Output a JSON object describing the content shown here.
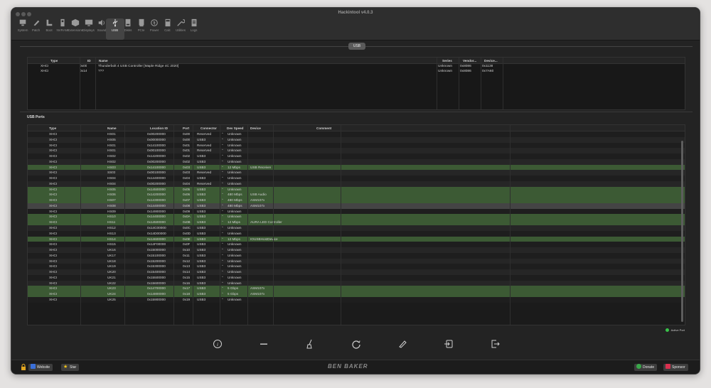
{
  "window": {
    "title": "Hackintool v4.0.3"
  },
  "toolbar": [
    {
      "label": "System",
      "icon": "monitor-icon"
    },
    {
      "label": "Patch",
      "icon": "pencil-icon"
    },
    {
      "label": "Boot",
      "icon": "boot-icon"
    },
    {
      "label": "NVRAM",
      "icon": "chip-icon"
    },
    {
      "label": "Extensions",
      "icon": "cube-icon"
    },
    {
      "label": "Displays",
      "icon": "display-icon"
    },
    {
      "label": "Sound",
      "icon": "speaker-icon"
    },
    {
      "label": "USB",
      "icon": "usb-icon",
      "active": true
    },
    {
      "label": "Disks",
      "icon": "disk-icon"
    },
    {
      "label": "PCIe",
      "icon": "card-icon"
    },
    {
      "label": "Power",
      "icon": "power-icon"
    },
    {
      "label": "Calc",
      "icon": "calculator-icon"
    },
    {
      "label": "Utilities",
      "icon": "wrench-icon"
    },
    {
      "label": "Logs",
      "icon": "log-icon"
    }
  ],
  "section_tab": "USB",
  "controllers": {
    "headers": {
      "type": "Type",
      "id": "ID",
      "name": "Name",
      "series": "Series",
      "vendor": "Vendor...",
      "device": "Device..."
    },
    "rows": [
      {
        "type": "XHCI",
        "id": "0x00",
        "name": "Thunderbolt 4 USB Controller [Maple Ridge 4C 2020]",
        "series": "Unknown",
        "vendor": "0x8086",
        "device": "0x1138"
      },
      {
        "type": "XHCI",
        "id": "0x14",
        "name": "???",
        "series": "Unknown",
        "vendor": "0x8086",
        "device": "0x7A60"
      }
    ]
  },
  "ports": {
    "label": "USB Ports",
    "headers": {
      "type": "Type",
      "name": "Name",
      "location": "Location ID",
      "port": "Port",
      "connector": "Connector",
      "speed": "Dev Speed",
      "device": "Device",
      "comment": "Comment"
    },
    "rows": [
      {
        "type": "XHCI",
        "name": "HS01",
        "location": "0x00200000",
        "port": "0x00",
        "connector": "Reserved",
        "speed": "Unknown",
        "device": "",
        "hl": ""
      },
      {
        "type": "XHCI",
        "name": "HS05",
        "location": "0x00000000",
        "port": "0x00",
        "connector": "USB3",
        "speed": "Unknown",
        "device": "",
        "hl": ""
      },
      {
        "type": "XHCI",
        "name": "HS01",
        "location": "0x14100000",
        "port": "0x01",
        "connector": "Reserved",
        "speed": "Unknown",
        "device": "",
        "hl": ""
      },
      {
        "type": "XHCI",
        "name": "HS01",
        "location": "0x00100000",
        "port": "0x01",
        "connector": "Reserved",
        "speed": "Unknown",
        "device": "",
        "hl": ""
      },
      {
        "type": "XHCI",
        "name": "HS02",
        "location": "0x14200000",
        "port": "0x02",
        "connector": "USB3",
        "speed": "Unknown",
        "device": "",
        "hl": ""
      },
      {
        "type": "XHCI",
        "name": "HS02",
        "location": "0x00200000",
        "port": "0x02",
        "connector": "USB3",
        "speed": "Unknown",
        "device": "",
        "hl": ""
      },
      {
        "type": "XHCI",
        "name": "HS03",
        "location": "0x14100000",
        "port": "0x03",
        "connector": "USB3",
        "speed": "12 Mbps",
        "device": "USB Receiver",
        "hl": "green"
      },
      {
        "type": "XHCI",
        "name": "SS03",
        "location": "0x00100000",
        "port": "0x03",
        "connector": "Reserved",
        "speed": "Unknown",
        "device": "",
        "hl": ""
      },
      {
        "type": "XHCI",
        "name": "HS04",
        "location": "0x14400000",
        "port": "0x04",
        "connector": "USB3",
        "speed": "Unknown",
        "device": "",
        "hl": ""
      },
      {
        "type": "XHCI",
        "name": "HS04",
        "location": "0x00200000",
        "port": "0x04",
        "connector": "Reserved",
        "speed": "Unknown",
        "device": "",
        "hl": ""
      },
      {
        "type": "XHCI",
        "name": "HS05",
        "location": "0x14500000",
        "port": "0x05",
        "connector": "USB3",
        "speed": "Unknown",
        "device": "",
        "hl": "green"
      },
      {
        "type": "XHCI",
        "name": "HS06",
        "location": "0x14200000",
        "port": "0x06",
        "connector": "USB3",
        "speed": "480 Mbps",
        "device": "USB Audio",
        "hl": "green"
      },
      {
        "type": "XHCI",
        "name": "HS07",
        "location": "0x14300000",
        "port": "0x07",
        "connector": "USB3",
        "speed": "480 Mbps",
        "device": "ASM107x",
        "hl": "green"
      },
      {
        "type": "XHCI",
        "name": "HS08",
        "location": "0x14400000",
        "port": "0x08",
        "connector": "USB3",
        "speed": "480 Mbps",
        "device": "ASM107x",
        "hl": "sel"
      },
      {
        "type": "XHCI",
        "name": "HS09",
        "location": "0x14900000",
        "port": "0x09",
        "connector": "USB3",
        "speed": "Unknown",
        "device": "",
        "hl": ""
      },
      {
        "type": "XHCI",
        "name": "HS10",
        "location": "0x14400000",
        "port": "0x0A",
        "connector": "USB3",
        "speed": "Unknown",
        "device": "",
        "hl": "green"
      },
      {
        "type": "XHCI",
        "name": "HS11",
        "location": "0x14500000",
        "port": "0x0B",
        "connector": "USB3",
        "speed": "12 Mbps",
        "device": "AURA LED Controller",
        "hl": "green"
      },
      {
        "type": "XHCI",
        "name": "HS12",
        "location": "0x14C00000",
        "port": "0x0C",
        "connector": "USB3",
        "speed": "Unknown",
        "device": "",
        "hl": ""
      },
      {
        "type": "XHCI",
        "name": "HS13",
        "location": "0x14D00000",
        "port": "0x0D",
        "connector": "USB3",
        "speed": "Unknown",
        "device": "",
        "hl": ""
      },
      {
        "type": "XHCI",
        "name": "HS14",
        "location": "0x14600000",
        "port": "0x0E",
        "connector": "USB3",
        "speed": "12 Mbps",
        "device": "IOUSBHostDevice",
        "hl": "green"
      },
      {
        "type": "XHCI",
        "name": "HS15",
        "location": "0x14F00000",
        "port": "0x0F",
        "connector": "USB3",
        "speed": "Unknown",
        "device": "",
        "hl": ""
      },
      {
        "type": "XHCI",
        "name": "UK16",
        "location": "0x15000000",
        "port": "0x10",
        "connector": "USB3",
        "speed": "Unknown",
        "device": "",
        "hl": ""
      },
      {
        "type": "XHCI",
        "name": "UK17",
        "location": "0x15100000",
        "port": "0x11",
        "connector": "USB3",
        "speed": "Unknown",
        "device": "",
        "hl": ""
      },
      {
        "type": "XHCI",
        "name": "UK18",
        "location": "0x15200000",
        "port": "0x12",
        "connector": "USB3",
        "speed": "Unknown",
        "device": "",
        "hl": ""
      },
      {
        "type": "XHCI",
        "name": "UK19",
        "location": "0x15300000",
        "port": "0x13",
        "connector": "USB3",
        "speed": "Unknown",
        "device": "",
        "hl": ""
      },
      {
        "type": "XHCI",
        "name": "UK20",
        "location": "0x15400000",
        "port": "0x14",
        "connector": "USB3",
        "speed": "Unknown",
        "device": "",
        "hl": ""
      },
      {
        "type": "XHCI",
        "name": "UK21",
        "location": "0x15500000",
        "port": "0x15",
        "connector": "USB3",
        "speed": "Unknown",
        "device": "",
        "hl": ""
      },
      {
        "type": "XHCI",
        "name": "UK22",
        "location": "0x15600000",
        "port": "0x16",
        "connector": "USB3",
        "speed": "Unknown",
        "device": "",
        "hl": ""
      },
      {
        "type": "XHCI",
        "name": "UK23",
        "location": "0x14700000",
        "port": "0x17",
        "connector": "USB3",
        "speed": "5 Gbps",
        "device": "ASM107x",
        "hl": "green"
      },
      {
        "type": "XHCI",
        "name": "UK24",
        "location": "0x14800000",
        "port": "0x18",
        "connector": "USB3",
        "speed": "5 Gbps",
        "device": "ASM107x",
        "hl": "green"
      },
      {
        "type": "XHCI",
        "name": "UK25",
        "location": "0x15900000",
        "port": "0x19",
        "connector": "USB3",
        "speed": "Unknown",
        "device": "",
        "hl": ""
      }
    ]
  },
  "legend": {
    "active_port": "Active Port",
    "color": "#39c34a"
  },
  "bottom_icons": [
    "info-icon",
    "remove-icon",
    "clean-icon",
    "refresh-icon",
    "edit-icon",
    "import-icon",
    "export-icon"
  ],
  "footer": {
    "website": "Website",
    "star": "Star",
    "brand": "BEN BAKER",
    "donate": "Donate",
    "sponsor": "Sponsor"
  },
  "colors": {
    "highlight_green": "#3c5a34",
    "selected": "#444444",
    "accent_blue": "#3a6fd8"
  }
}
